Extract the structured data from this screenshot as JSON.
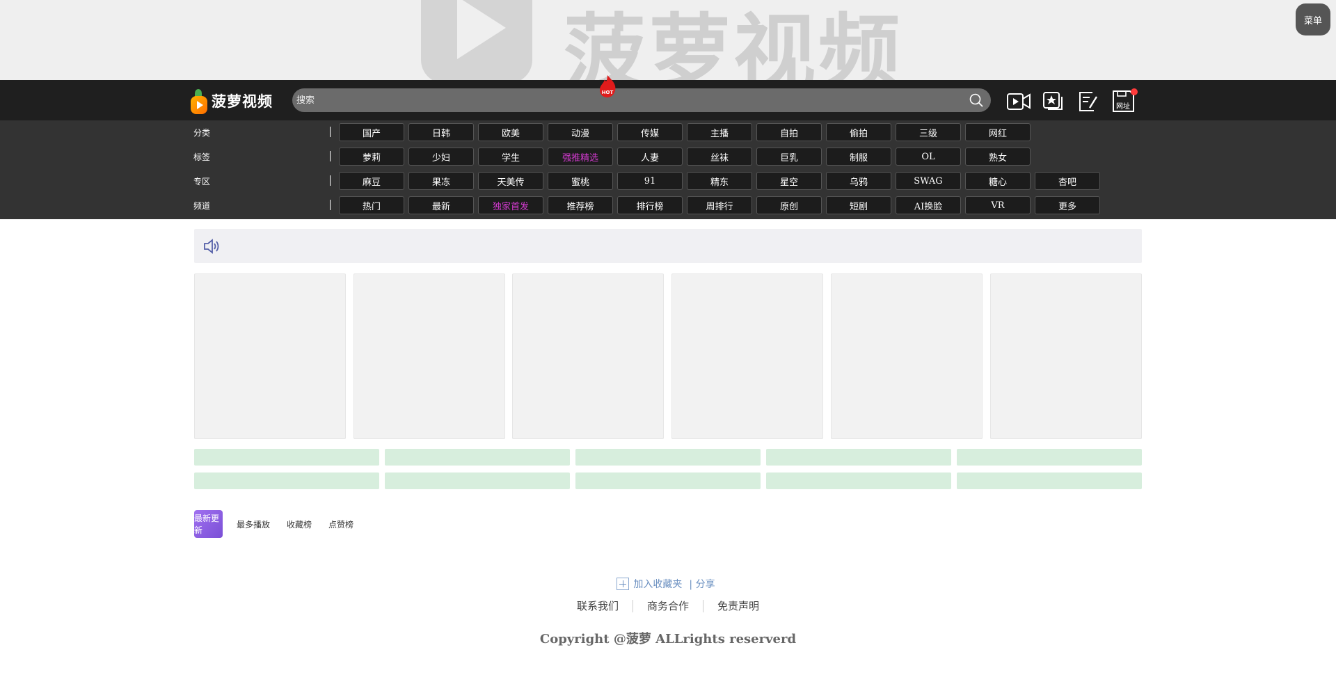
{
  "banner": {
    "logo_text": "菠萝视频",
    "corner_button": "菜单"
  },
  "header": {
    "logo_text": "菠萝视频",
    "search_placeholder": "搜索",
    "icons": [
      "video-camera-icon",
      "star-collection-icon",
      "edit-note-icon",
      "website-save-icon"
    ],
    "website_label": "网址",
    "badge_color": "#ff3b3b"
  },
  "catnav": {
    "rows": [
      {
        "label": "分类",
        "items": [
          "国产",
          "日韩",
          "欧美",
          "动漫",
          "传媒",
          "主播",
          "自拍",
          "偷拍",
          "三级",
          "网红"
        ]
      },
      {
        "label": "标签",
        "items": [
          "萝莉",
          "少妇",
          "学生",
          "强推精选",
          "人妻",
          "丝袜",
          "巨乳",
          "制服",
          "OL",
          "熟女"
        ]
      },
      {
        "label": "专区",
        "items": [
          "麻豆",
          "果冻",
          "天美传",
          "蜜桃",
          "91",
          "精东",
          "星空",
          "乌鸦",
          "SWAG",
          "糖心",
          "杏吧"
        ]
      },
      {
        "label": "频道",
        "items": [
          "热门",
          "最新",
          "独家首发",
          "推荐榜",
          "排行榜",
          "周排行",
          "原创",
          "短剧",
          "AI换脸",
          "VR",
          "更多"
        ]
      }
    ],
    "highlight_color": "#d43ad1",
    "highlighted": [
      [
        1,
        3
      ],
      [
        3,
        2
      ]
    ]
  },
  "tabs": [
    "最新更新",
    "最多播放",
    "收藏榜",
    "点赞榜"
  ],
  "footer": {
    "add_text": "加入收藏夹",
    "add_suffix": "| 分享",
    "links": [
      "联系我们",
      "商务合作",
      "免责声明"
    ],
    "copyright": "Copyright @菠萝 ALLrights reserverd"
  }
}
